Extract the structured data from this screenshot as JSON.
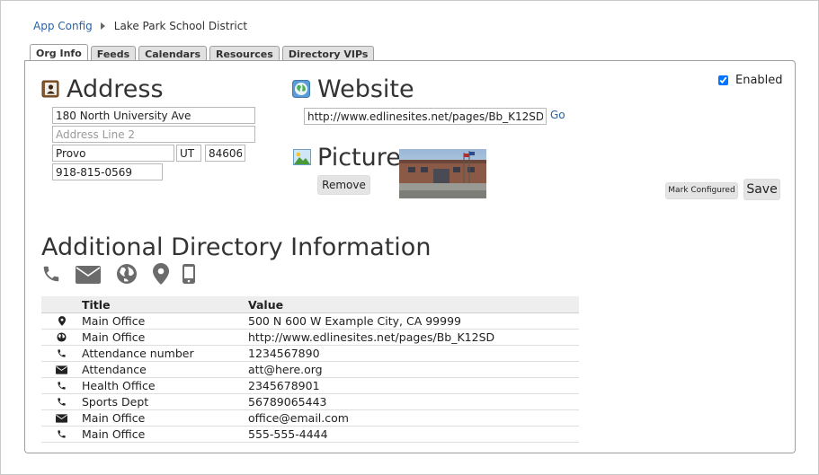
{
  "breadcrumb": {
    "root": "App Config",
    "current": "Lake Park School District"
  },
  "tabs": [
    {
      "label": "Org Info",
      "active": true
    },
    {
      "label": "Feeds",
      "active": false
    },
    {
      "label": "Calendars",
      "active": false
    },
    {
      "label": "Resources",
      "active": false
    },
    {
      "label": "Directory VIPs",
      "active": false
    }
  ],
  "address": {
    "title": "Address",
    "line1": "180 North University Ave",
    "line2_placeholder": "Address Line 2",
    "city": "Provo",
    "state": "UT",
    "zip": "84606",
    "phone": "918-815-0569"
  },
  "website": {
    "title": "Website",
    "url": "http://www.edlinesites.net/pages/Bb_K12SD",
    "go_label": "Go"
  },
  "picture": {
    "title": "Picture",
    "remove_label": "Remove"
  },
  "enabled": {
    "label": "Enabled",
    "checked": true
  },
  "actions": {
    "mark_configured_label": "Mark Configured",
    "save_label": "Save"
  },
  "directory": {
    "title": "Additional Directory Information",
    "contact_types": [
      "phone-icon",
      "email-icon",
      "globe-icon",
      "location-pin-icon",
      "mobile-icon"
    ],
    "columns": [
      "Title",
      "Value"
    ],
    "rows": [
      {
        "icon": "location-pin-icon",
        "title": "Main Office",
        "value": "500 N 600 W Example City, CA 99999"
      },
      {
        "icon": "globe-icon",
        "title": "Main Office",
        "value": "http://www.edlinesites.net/pages/Bb_K12SD"
      },
      {
        "icon": "phone-icon",
        "title": "Attendance number",
        "value": "1234567890"
      },
      {
        "icon": "email-icon",
        "title": "Attendance",
        "value": "att@here.org"
      },
      {
        "icon": "phone-icon",
        "title": "Health Office",
        "value": "2345678901"
      },
      {
        "icon": "phone-icon",
        "title": "Sports Dept",
        "value": "56789065443"
      },
      {
        "icon": "email-icon",
        "title": "Main Office",
        "value": "office@email.com"
      },
      {
        "icon": "phone-icon",
        "title": "Main Office",
        "value": "555-555-4444"
      }
    ]
  },
  "colors": {
    "link": "#2a62a6",
    "icon_gray": "#6b6b6b",
    "header_bg": "#eeeeee"
  }
}
